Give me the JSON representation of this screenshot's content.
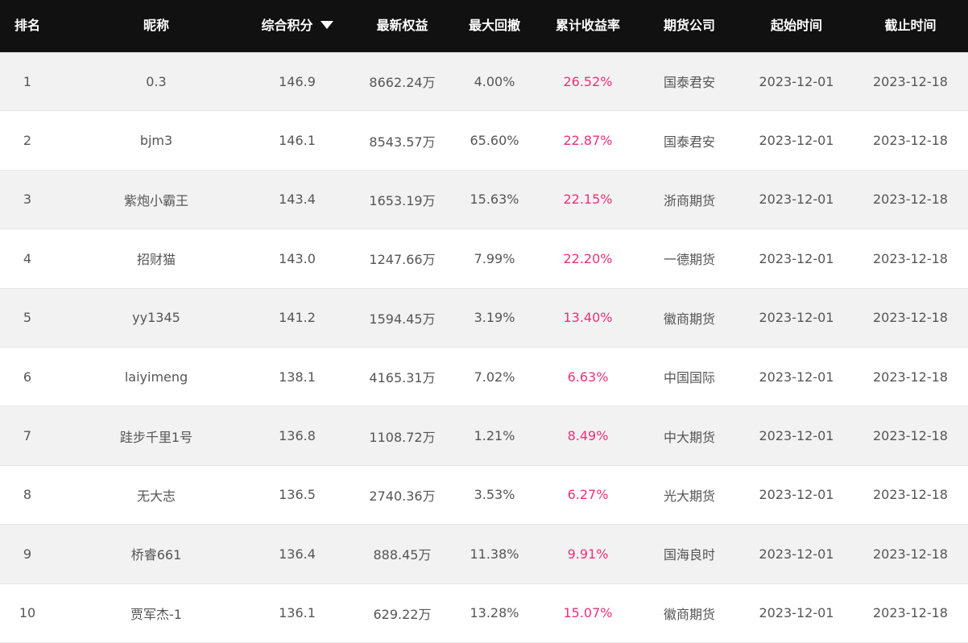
{
  "headers": {
    "rank": "排名",
    "nickname": "昵称",
    "score": "综合积分",
    "equity": "最新权益",
    "drawdown": "最大回撤",
    "return": "累计收益率",
    "company": "期货公司",
    "start": "起始时间",
    "end": "截止时间"
  },
  "icons": {
    "sort": "sort-descending-icon"
  },
  "colors": {
    "header_bg": "#111111",
    "return_text": "#e8317a",
    "row_alt": "#f2f2f2"
  },
  "rows": [
    {
      "rank": "1",
      "nickname": "0.3",
      "score": "146.9",
      "equity": "8662.24万",
      "drawdown": "4.00%",
      "return": "26.52%",
      "company": "国泰君安",
      "start": "2023-12-01",
      "end": "2023-12-18"
    },
    {
      "rank": "2",
      "nickname": "bjm3",
      "score": "146.1",
      "equity": "8543.57万",
      "drawdown": "65.60%",
      "return": "22.87%",
      "company": "国泰君安",
      "start": "2023-12-01",
      "end": "2023-12-18"
    },
    {
      "rank": "3",
      "nickname": "紫炮小霸王",
      "score": "143.4",
      "equity": "1653.19万",
      "drawdown": "15.63%",
      "return": "22.15%",
      "company": "浙商期货",
      "start": "2023-12-01",
      "end": "2023-12-18"
    },
    {
      "rank": "4",
      "nickname": "招财猫",
      "score": "143.0",
      "equity": "1247.66万",
      "drawdown": "7.99%",
      "return": "22.20%",
      "company": "一德期货",
      "start": "2023-12-01",
      "end": "2023-12-18"
    },
    {
      "rank": "5",
      "nickname": "yy1345",
      "score": "141.2",
      "equity": "1594.45万",
      "drawdown": "3.19%",
      "return": "13.40%",
      "company": "徽商期货",
      "start": "2023-12-01",
      "end": "2023-12-18"
    },
    {
      "rank": "6",
      "nickname": "laiyimeng",
      "score": "138.1",
      "equity": "4165.31万",
      "drawdown": "7.02%",
      "return": "6.63%",
      "company": "中国国际",
      "start": "2023-12-01",
      "end": "2023-12-18"
    },
    {
      "rank": "7",
      "nickname": "跬步千里1号",
      "score": "136.8",
      "equity": "1108.72万",
      "drawdown": "1.21%",
      "return": "8.49%",
      "company": "中大期货",
      "start": "2023-12-01",
      "end": "2023-12-18"
    },
    {
      "rank": "8",
      "nickname": "无大志",
      "score": "136.5",
      "equity": "2740.36万",
      "drawdown": "3.53%",
      "return": "6.27%",
      "company": "光大期货",
      "start": "2023-12-01",
      "end": "2023-12-18"
    },
    {
      "rank": "9",
      "nickname": "桥睿661",
      "score": "136.4",
      "equity": "888.45万",
      "drawdown": "11.38%",
      "return": "9.91%",
      "company": "国海良时",
      "start": "2023-12-01",
      "end": "2023-12-18"
    },
    {
      "rank": "10",
      "nickname": "贾军杰-1",
      "score": "136.1",
      "equity": "629.22万",
      "drawdown": "13.28%",
      "return": "15.07%",
      "company": "徽商期货",
      "start": "2023-12-01",
      "end": "2023-12-18"
    }
  ]
}
